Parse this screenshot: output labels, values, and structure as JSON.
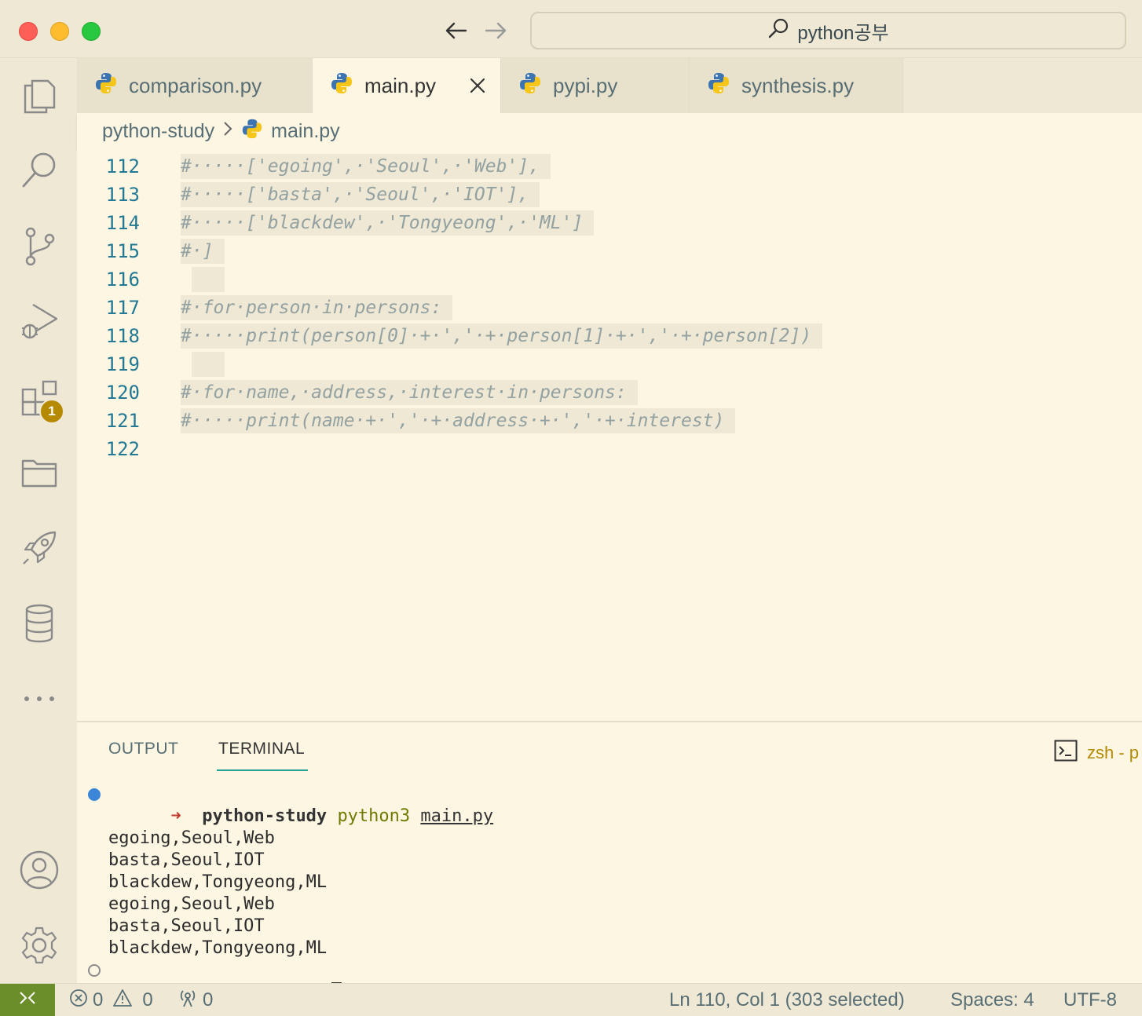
{
  "titlebar": {
    "search_text": "python공부"
  },
  "activity_bar": {
    "items": [
      "explorer-icon",
      "search-icon",
      "source-control-icon",
      "run-debug-icon",
      "extensions-icon",
      "folder-icon",
      "rocket-icon",
      "database-icon",
      "more-icon"
    ],
    "extensions_badge": "1",
    "bottom": [
      "account-icon",
      "settings-gear-icon"
    ]
  },
  "tabs": [
    {
      "label": "comparison.py",
      "active": false
    },
    {
      "label": "main.py",
      "active": true
    },
    {
      "label": "pypi.py",
      "active": false
    },
    {
      "label": "synthesis.py",
      "active": false
    }
  ],
  "breadcrumb": {
    "folder": "python-study",
    "file": "main.py"
  },
  "editor": {
    "lines": [
      {
        "num": "112",
        "text": "#·····['egoing',·'Seoul',·'Web'],"
      },
      {
        "num": "113",
        "text": "#·····['basta',·'Seoul',·'IOT'],"
      },
      {
        "num": "114",
        "text": "#·····['blackdew',·'Tongyeong',·'ML']"
      },
      {
        "num": "115",
        "text": "#·]"
      },
      {
        "num": "116",
        "text": ""
      },
      {
        "num": "117",
        "text": "#·for·person·in·persons:"
      },
      {
        "num": "118",
        "text": "#·····print(person[0]·+·','·+·person[1]·+·','·+·person[2])"
      },
      {
        "num": "119",
        "text": ""
      },
      {
        "num": "120",
        "text": "#·for·name,·address,·interest·in·persons:"
      },
      {
        "num": "121",
        "text": "#·····print(name·+·','·+·address·+·','·+·interest)"
      },
      {
        "num": "122",
        "text": ""
      }
    ]
  },
  "panel": {
    "tabs": {
      "output": "OUTPUT",
      "terminal": "TERMINAL"
    },
    "active_tab": "TERMINAL",
    "terminal_name": "zsh - p",
    "prompt_arrow": "➜",
    "prompt_dir": "python-study",
    "command": "python3",
    "command_arg": "main.py",
    "output": [
      "egoing,Seoul,Web",
      "basta,Seoul,IOT",
      "blackdew,Tongyeong,ML",
      "egoing,Seoul,Web",
      "basta,Seoul,IOT",
      "blackdew,Tongyeong,ML"
    ]
  },
  "statusbar": {
    "errors": "0",
    "warnings": "0",
    "ports": "0",
    "position": "Ln 110, Col 1 (303 selected)",
    "spaces": "Spaces: 4",
    "encoding": "UTF-8"
  },
  "colors": {
    "background": "#fdf6e3",
    "sidebar": "#eee8d5",
    "line_numbers": "#237893",
    "comment": "#93a1a1",
    "badge": "#b58900",
    "remote": "#6c8e2a"
  }
}
